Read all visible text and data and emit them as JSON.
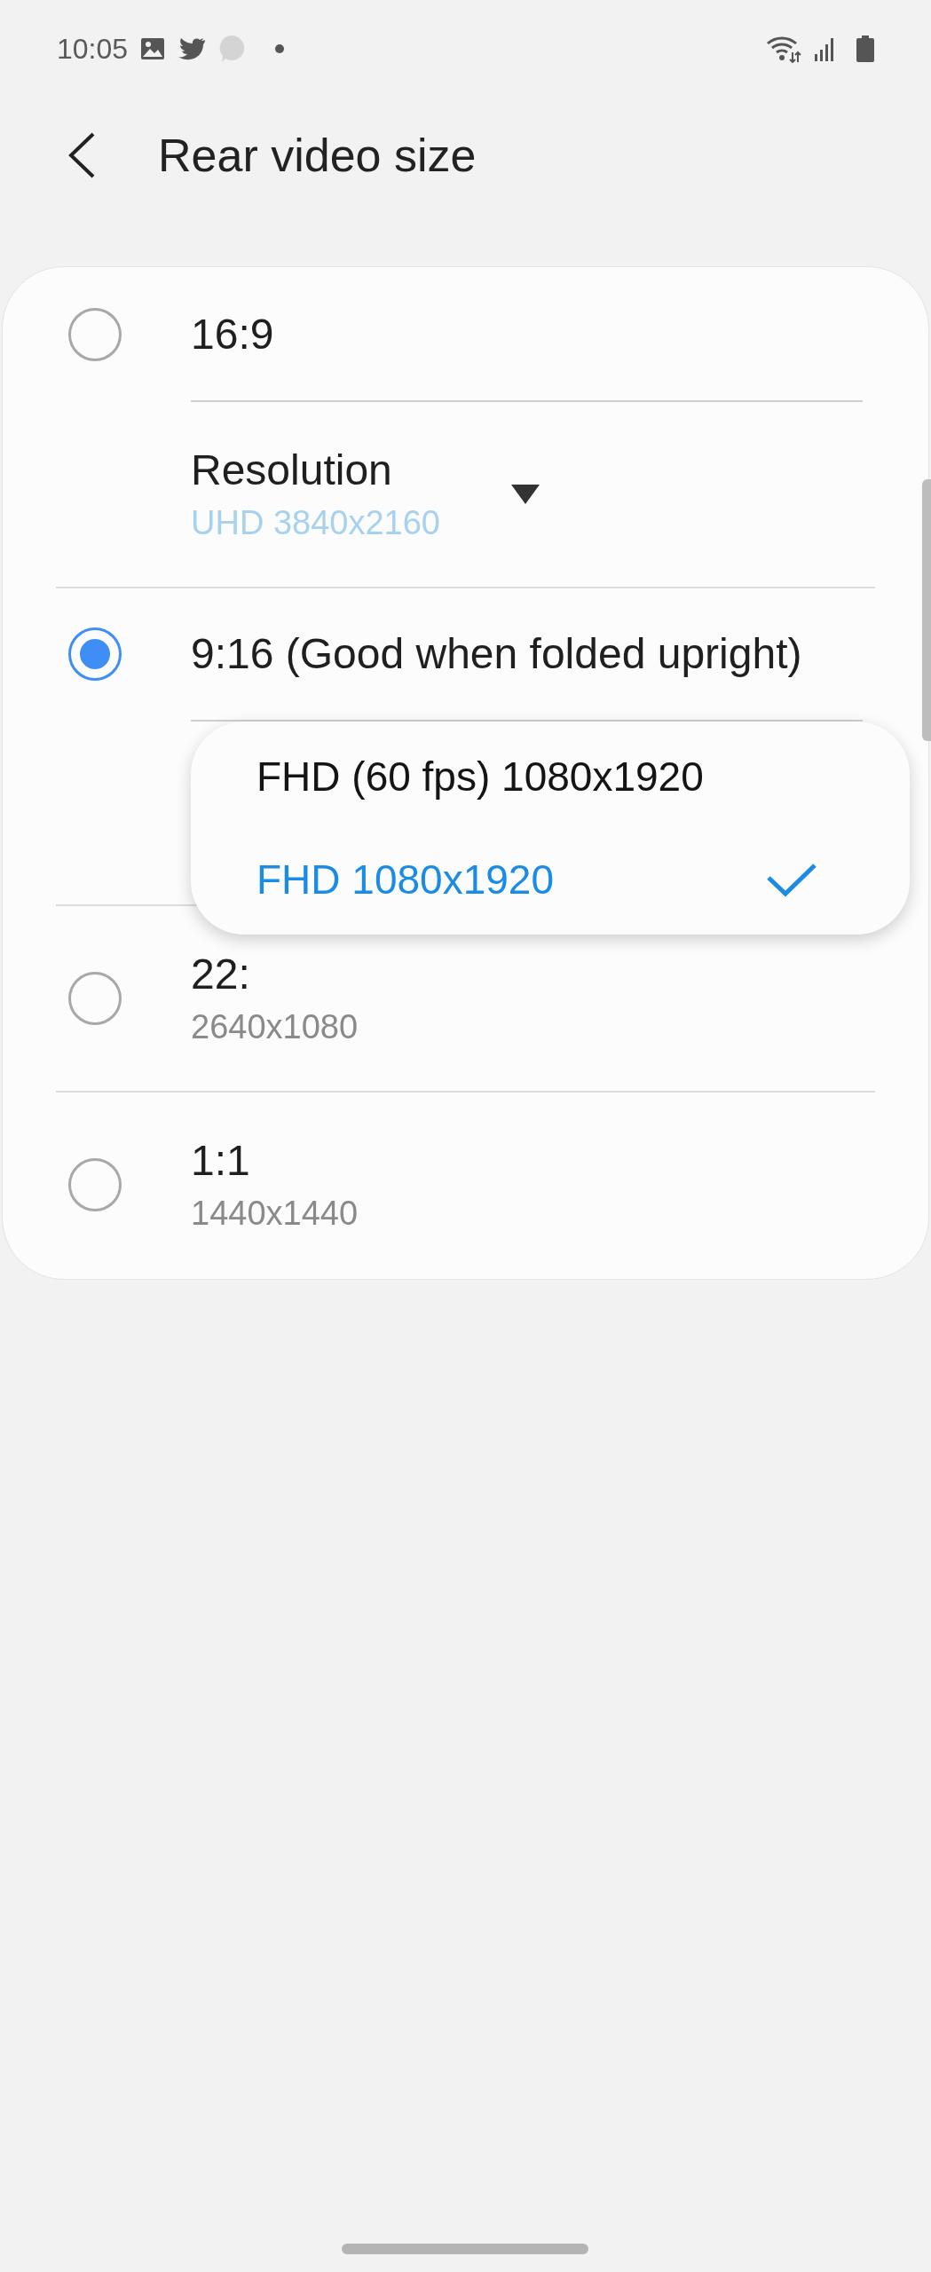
{
  "status_bar": {
    "time": "10:05"
  },
  "header": {
    "title": "Rear video size"
  },
  "options": [
    {
      "label": "16:9",
      "selected": false,
      "resolution": {
        "label": "Resolution",
        "value": "UHD 3840x2160"
      }
    },
    {
      "label": "9:16 (Good when folded upright)",
      "selected": true,
      "dropdown": [
        {
          "label": "FHD (60 fps) 1080x1920",
          "selected": false
        },
        {
          "label": "FHD 1080x1920",
          "selected": true
        }
      ]
    },
    {
      "label": "22:",
      "subtitle": "2640x1080",
      "selected": false
    },
    {
      "label": "1:1",
      "subtitle": "1440x1440",
      "selected": false
    }
  ]
}
